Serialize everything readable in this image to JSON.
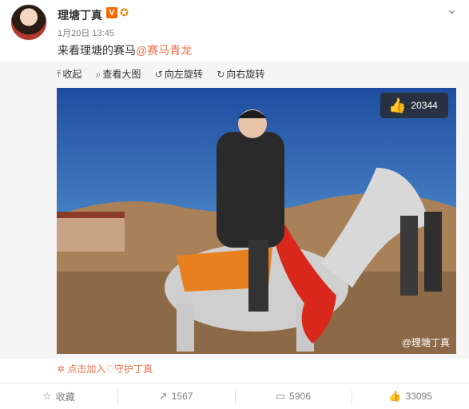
{
  "post": {
    "username": "理塘丁真",
    "time": "1月20日 13:45",
    "text_prefix": "来看理塘的赛马",
    "mention": "@赛马青龙"
  },
  "toolbar": {
    "collapse": "收起",
    "view_large": "查看大图",
    "rotate_left": "向左旋转",
    "rotate_right": "向右旋转"
  },
  "photo": {
    "likes": "20344",
    "watermark": "@理塘丁真"
  },
  "guard_link": "点击加入♡守护丁真",
  "footer": {
    "favorite": "收藏",
    "repost": "1567",
    "comment": "5906",
    "like": "33095"
  },
  "colors": {
    "accent": "#eb7350",
    "badge": "#f56800"
  },
  "icons": [
    "chevron-down-icon",
    "collapse-icon",
    "search-icon",
    "rotate-left-icon",
    "rotate-right-icon",
    "thumb-up-icon",
    "star-icon",
    "repost-icon",
    "comment-icon"
  ]
}
